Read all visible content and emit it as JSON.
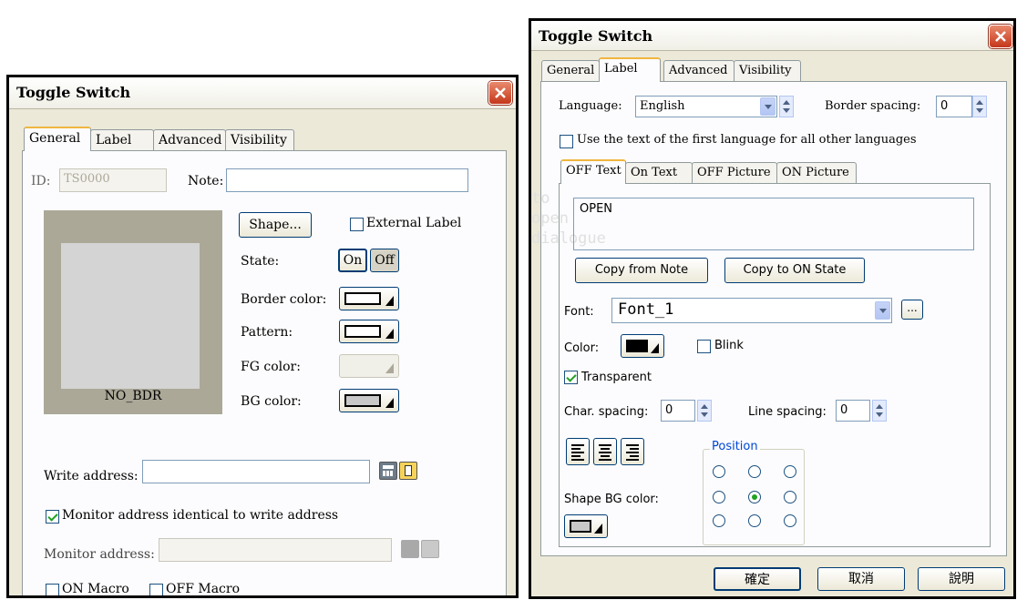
{
  "left_dialog": {
    "title": "Toggle Switch",
    "tabs": [
      "General",
      "Label",
      "Advanced",
      "Visibility"
    ],
    "active_tab": "General",
    "id_label": "ID:",
    "id_value": "TS0000",
    "note_label": "Note:",
    "note_value": "",
    "preview_text": "NO_BDR",
    "shape_button": "Shape...",
    "external_label": "External Label",
    "external_label_checked": false,
    "state_label": "State:",
    "state_on": "On",
    "state_off": "Off",
    "border_color_label": "Border color:",
    "pattern_label": "Pattern:",
    "fg_color_label": "FG color:",
    "bg_color_label": "BG color:",
    "write_address_label": "Write address:",
    "write_address_value": "",
    "monitor_identical_label": "Monitor address identical to write address",
    "monitor_identical_checked": true,
    "monitor_address_label": "Monitor address:",
    "monitor_address_value": "",
    "on_macro_label": "ON Macro",
    "off_macro_label": "OFF Macro"
  },
  "right_dialog": {
    "title": "Toggle Switch",
    "tabs": [
      "General",
      "Label",
      "Advanced",
      "Visibility"
    ],
    "active_tab": "Label",
    "language_label": "Language:",
    "language_value": "English",
    "border_spacing_label": "Border spacing:",
    "border_spacing_value": "0",
    "use_first_language_label": "Use the text of the first language for all other languages",
    "use_first_language_checked": false,
    "subtabs": [
      "OFF Text",
      "On Text",
      "OFF Picture",
      "ON Picture"
    ],
    "active_subtab": "OFF Text",
    "ghost_text": "to open dialogue",
    "text_value": "OPEN",
    "copy_from_note_button": "Copy from Note",
    "copy_to_on_button": "Copy to ON State",
    "font_label": "Font:",
    "font_value": "Font_1",
    "font_more_button": "...",
    "color_label": "Color:",
    "blink_label": "Blink",
    "blink_checked": false,
    "transparent_label": "Transparent",
    "transparent_checked": true,
    "char_spacing_label": "Char. spacing:",
    "char_spacing_value": "0",
    "line_spacing_label": "Line spacing:",
    "line_spacing_value": "0",
    "position_label": "Position",
    "position_selected": "middle-center",
    "shape_bg_color_label": "Shape BG color:",
    "ok_button": "確定",
    "cancel_button": "取消",
    "help_button": "說明"
  },
  "colors": {
    "dialog_bg": "#ece9d8",
    "panel_bg": "#fcfcfe",
    "preview_border": "#aba898",
    "preview_fill": "#d4d4d4",
    "close_red": "#c5371b",
    "check_green": "#21a121"
  }
}
